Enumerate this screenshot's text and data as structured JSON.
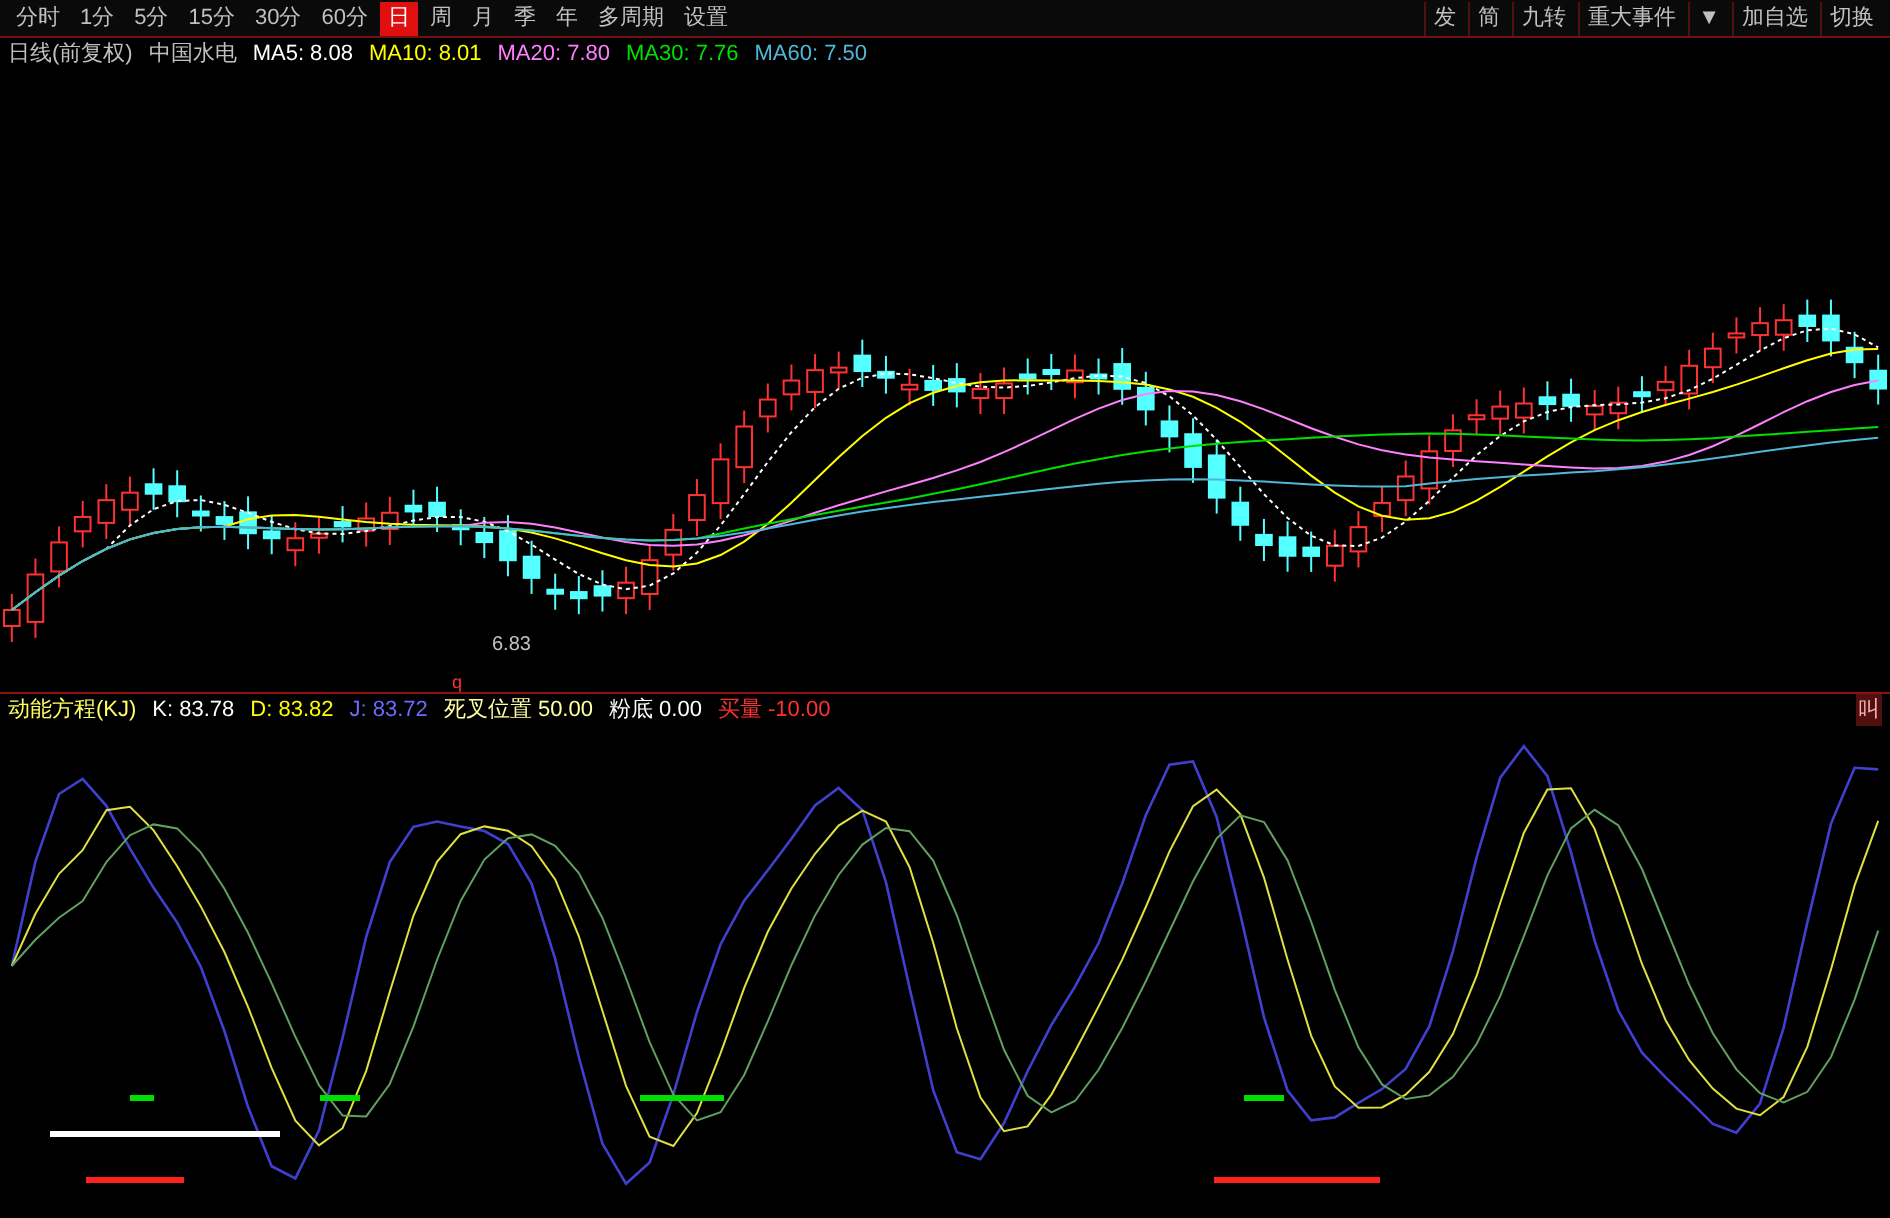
{
  "toolbar": [
    {
      "label": "分时",
      "selected": false
    },
    {
      "label": "1分",
      "selected": false
    },
    {
      "label": "5分",
      "selected": false
    },
    {
      "label": "15分",
      "selected": false
    },
    {
      "label": "30分",
      "selected": false
    },
    {
      "label": "60分",
      "selected": false
    },
    {
      "label": "日",
      "selected": true
    },
    {
      "label": "周",
      "selected": false
    },
    {
      "label": "月",
      "selected": false
    },
    {
      "label": "季",
      "selected": false
    },
    {
      "label": "年",
      "selected": false
    },
    {
      "label": "多周期",
      "selected": false
    },
    {
      "label": "设置",
      "selected": false
    }
  ],
  "right_toolbar": [
    {
      "label": "发"
    },
    {
      "label": "简"
    },
    {
      "label": "九转"
    },
    {
      "label": "重大事件"
    },
    {
      "label": "▼"
    },
    {
      "label": "加自选"
    },
    {
      "label": "切换"
    }
  ],
  "main_legend": {
    "title": "日线(前复权)",
    "stock": "中国水电",
    "items": [
      {
        "label": "MA5: 8.08",
        "color": "#ffffff"
      },
      {
        "label": "MA10: 8.01",
        "color": "#ffff00"
      },
      {
        "label": "MA20: 7.80",
        "color": "#ff80ff"
      },
      {
        "label": "MA30: 7.76",
        "color": "#00e000"
      },
      {
        "label": "MA60: 7.50",
        "color": "#4fb8d8"
      }
    ]
  },
  "low_label": "6.83",
  "marker_label": "q",
  "edge_label": "叫",
  "indicator_legend": {
    "title": "动能方程(KJ)",
    "items": [
      {
        "label": "K: 83.78",
        "color": "#ffffff"
      },
      {
        "label": "D: 83.82",
        "color": "#ffff00"
      },
      {
        "label": "J: 83.72",
        "color": "#6a6aff"
      },
      {
        "label": "死叉位置 50.00",
        "color": "#ffffa0"
      },
      {
        "label": "粉底 0.00",
        "color": "#ffffff"
      },
      {
        "label": "买量 -10.00",
        "color": "#ff3030"
      }
    ]
  }
}
